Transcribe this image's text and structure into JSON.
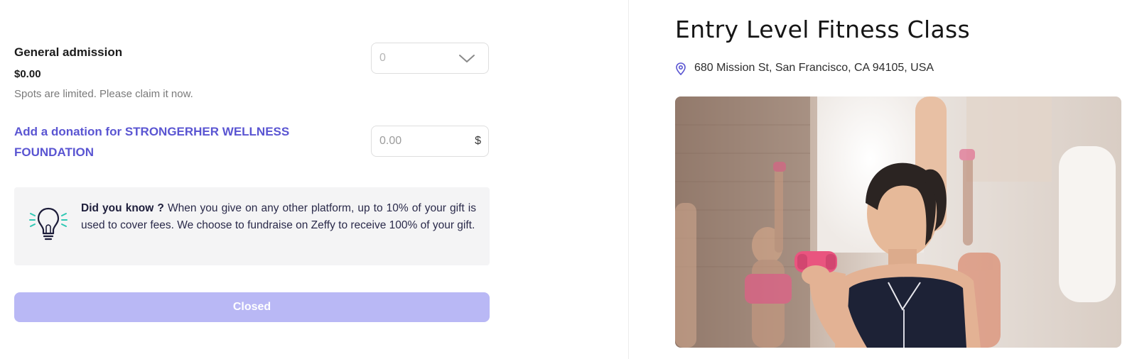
{
  "ticket": {
    "name": "General admission",
    "price": "$0.00",
    "note": "Spots are limited. Please claim it now.",
    "quantity": "0"
  },
  "donation": {
    "label": "Add a donation for STRONGERHER WELLNESS FOUNDATION",
    "placeholder": "0.00",
    "currency": "$"
  },
  "tip": {
    "heading": "Did you know ?",
    "body": " When you give on any other platform, up to 10% of your gift is used to cover fees. We choose to fundraise on Zeffy to receive 100% of your gift."
  },
  "action": {
    "button_label": "Closed"
  },
  "event": {
    "title": "Entry Level Fitness Class",
    "address": "680 Mission St, San Francisco, CA 94105, USA"
  },
  "colors": {
    "accent": "#5a55d2",
    "button_disabled": "#b9b8f5",
    "tip_background": "#f4f4f5",
    "icon_teal": "#2fc8b4"
  }
}
